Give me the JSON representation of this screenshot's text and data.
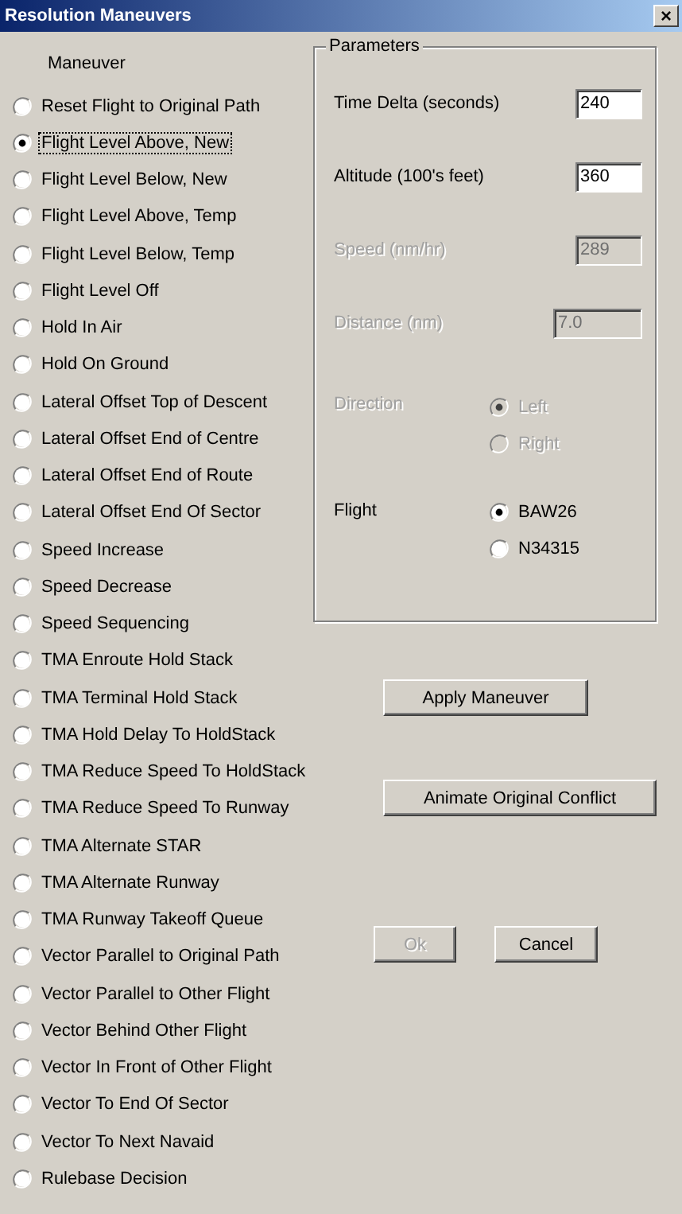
{
  "window": {
    "title": "Resolution Maneuvers",
    "close": "×"
  },
  "maneuver_header": "Maneuver",
  "maneuvers": [
    {
      "label": "Reset Flight to Original Path",
      "selected": false
    },
    {
      "label": "Flight Level Above, New",
      "selected": true
    },
    {
      "label": "Flight Level Below, New",
      "selected": false
    },
    {
      "label": "Flight Level Above, Temp",
      "selected": false
    },
    {
      "label": "Flight Level Below, Temp",
      "selected": false
    },
    {
      "label": "Flight Level Off",
      "selected": false
    },
    {
      "label": "Hold In Air",
      "selected": false
    },
    {
      "label": "Hold On Ground",
      "selected": false
    },
    {
      "label": "Lateral Offset Top of Descent",
      "selected": false
    },
    {
      "label": "Lateral Offset End of Centre",
      "selected": false
    },
    {
      "label": "Lateral Offset End of Route",
      "selected": false
    },
    {
      "label": "Lateral Offset End Of Sector",
      "selected": false
    },
    {
      "label": "Speed Increase",
      "selected": false
    },
    {
      "label": "Speed Decrease",
      "selected": false
    },
    {
      "label": "Speed Sequencing",
      "selected": false
    },
    {
      "label": "TMA Enroute Hold Stack",
      "selected": false
    },
    {
      "label": "TMA Terminal Hold Stack",
      "selected": false
    },
    {
      "label": "TMA Hold Delay To HoldStack",
      "selected": false
    },
    {
      "label": "TMA Reduce Speed To HoldStack",
      "selected": false
    },
    {
      "label": "TMA Reduce Speed To Runway",
      "selected": false
    },
    {
      "label": "TMA Alternate STAR",
      "selected": false
    },
    {
      "label": "TMA Alternate Runway",
      "selected": false
    },
    {
      "label": "TMA Runway Takeoff Queue",
      "selected": false
    },
    {
      "label": "Vector Parallel to Original Path",
      "selected": false
    },
    {
      "label": "Vector Parallel to Other Flight",
      "selected": false
    },
    {
      "label": "Vector Behind Other Flight",
      "selected": false
    },
    {
      "label": "Vector In Front of Other Flight",
      "selected": false
    },
    {
      "label": "Vector To End Of Sector",
      "selected": false
    },
    {
      "label": "Vector To Next Navaid",
      "selected": false
    },
    {
      "label": "Rulebase Decision",
      "selected": false
    }
  ],
  "parameters": {
    "title": "Parameters",
    "fields": [
      {
        "label": "Time Delta (seconds)",
        "value": "240",
        "disabled": false
      },
      {
        "label": "Altitude (100's feet)",
        "value": "360",
        "disabled": false
      },
      {
        "label": "Speed (nm/hr)",
        "value": "289",
        "disabled": true
      },
      {
        "label": "Distance (nm)",
        "value": "7.0",
        "disabled": true
      }
    ],
    "direction": {
      "label": "Direction",
      "disabled": true,
      "options": [
        {
          "label": "Left",
          "selected": true
        },
        {
          "label": "Right",
          "selected": false
        }
      ]
    },
    "flight": {
      "label": "Flight",
      "disabled": false,
      "options": [
        {
          "label": "BAW26",
          "selected": true
        },
        {
          "label": "N34315",
          "selected": false
        }
      ]
    }
  },
  "buttons": {
    "apply": {
      "label": "Apply Maneuver",
      "disabled": false
    },
    "animate": {
      "label": "Animate Original Conflict",
      "disabled": false
    },
    "ok": {
      "label": "Ok",
      "disabled": true
    },
    "cancel": {
      "label": "Cancel",
      "disabled": false
    }
  }
}
